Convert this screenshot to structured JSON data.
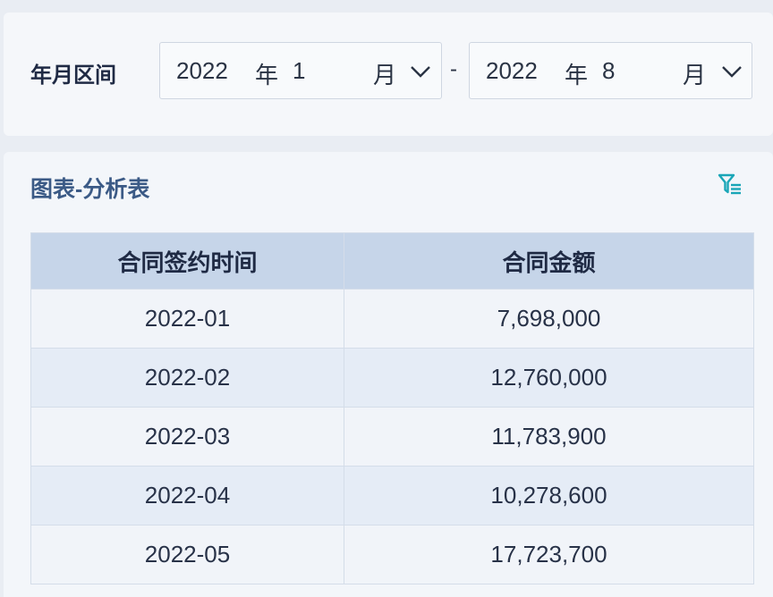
{
  "filter": {
    "label": "年月区间",
    "separator": "-",
    "start": {
      "year": "2022",
      "year_unit": "年",
      "month": "1",
      "month_unit": "月"
    },
    "end": {
      "year": "2022",
      "year_unit": "年",
      "month": "8",
      "month_unit": "月"
    }
  },
  "panel": {
    "title": "图表-分析表",
    "filter_icon": "filter-icon"
  },
  "table": {
    "columns": [
      "合同签约时间",
      "合同金额"
    ],
    "rows": [
      [
        "2022-01",
        "7,698,000"
      ],
      [
        "2022-02",
        "12,760,000"
      ],
      [
        "2022-03",
        "11,783,900"
      ],
      [
        "2022-04",
        "10,278,600"
      ],
      [
        "2022-05",
        "17,723,700"
      ]
    ]
  },
  "colors": {
    "header_bg": "#c6d5e9",
    "row_odd": "#f1f4f9",
    "row_even": "#e5ecf6",
    "title": "#3b5a86",
    "icon_accent": "#1aa6b7"
  }
}
